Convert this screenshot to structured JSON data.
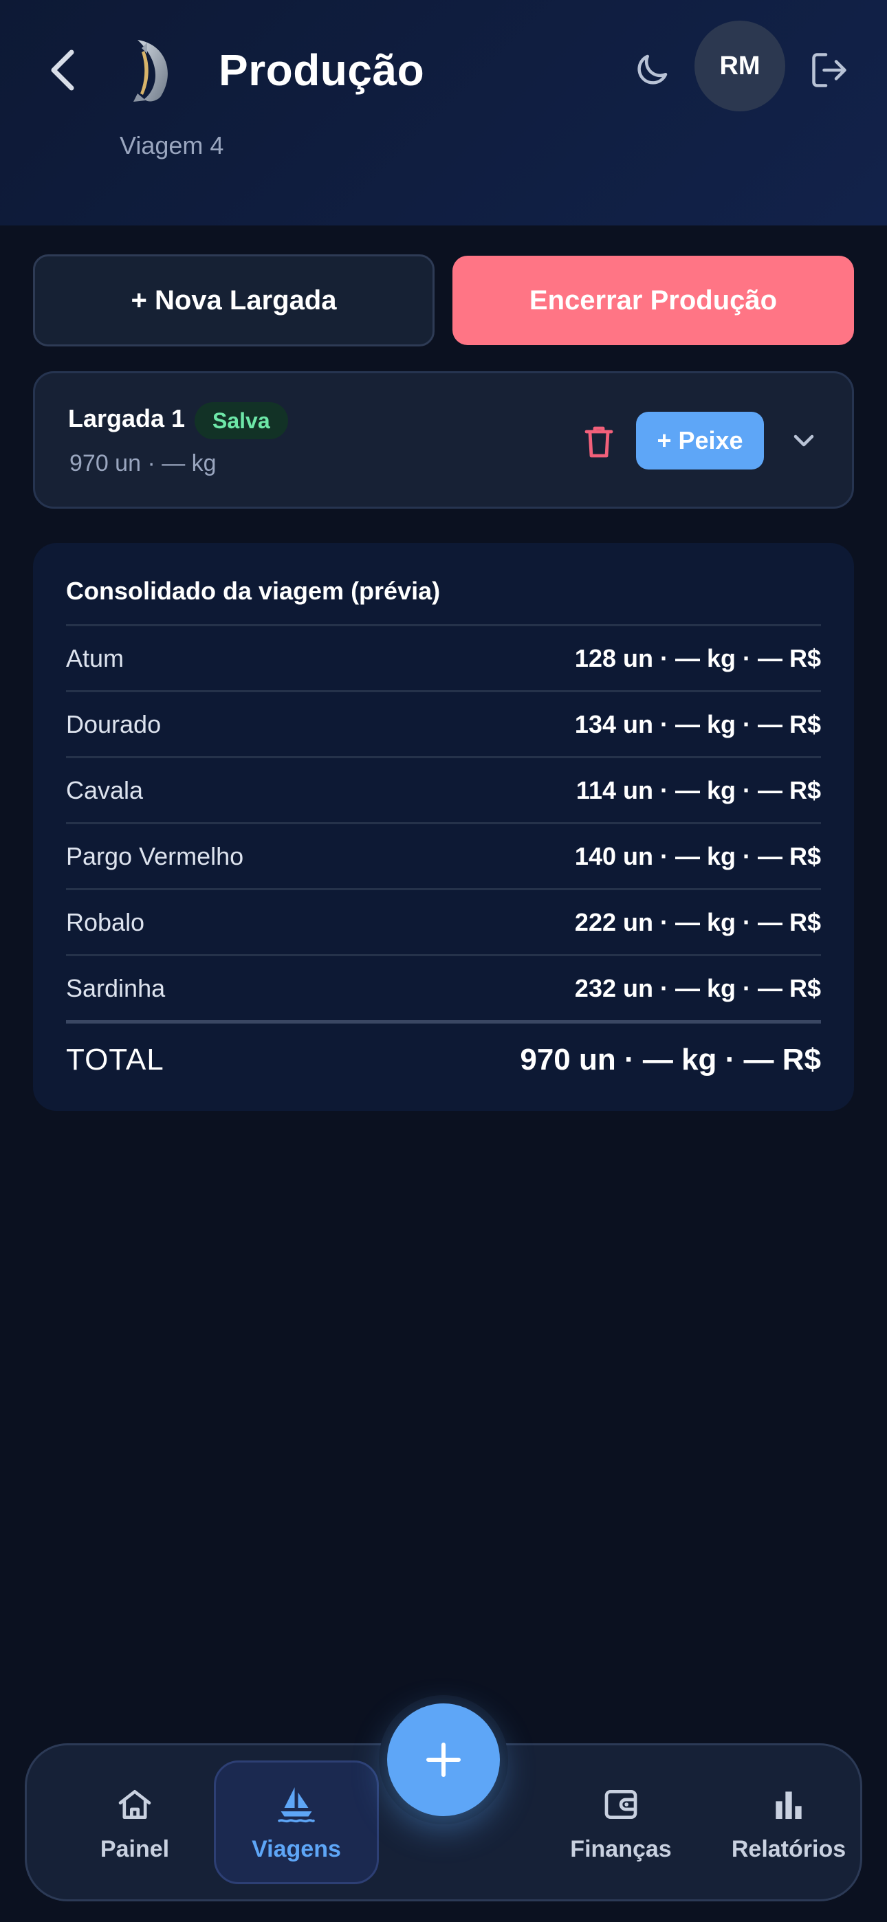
{
  "header": {
    "title": "Produção",
    "subtitle": "Viagem 4",
    "avatar_initials": "RM"
  },
  "actions": {
    "new_label": "+ Nova Largada",
    "close_label": "Encerrar Produção"
  },
  "largada": {
    "title": "Largada 1",
    "badge": "Salva",
    "summary": "970 un · — kg",
    "add_fish_label": "+ Peixe"
  },
  "consolidated": {
    "title": "Consolidado da viagem (prévia)",
    "rows": [
      {
        "name": "Atum",
        "value": "128 un · — kg · — R$"
      },
      {
        "name": "Dourado",
        "value": "134 un · — kg · — R$"
      },
      {
        "name": "Cavala",
        "value": "114 un · — kg · — R$"
      },
      {
        "name": "Pargo Vermelho",
        "value": "140 un · — kg · — R$"
      },
      {
        "name": "Robalo",
        "value": "222 un · — kg · — R$"
      },
      {
        "name": "Sardinha",
        "value": "232 un · — kg · — R$"
      }
    ],
    "total_label": "TOTAL",
    "total_value": "970 un · — kg · — R$"
  },
  "nav": {
    "items": [
      {
        "label": "Painel",
        "icon": "home-icon"
      },
      {
        "label": "Viagens",
        "icon": "sailboat-icon",
        "active": true
      },
      {
        "label": "Finanças",
        "icon": "wallet-icon"
      },
      {
        "label": "Relatórios",
        "icon": "bar-chart-icon"
      }
    ]
  },
  "colors": {
    "accent": "#5ea6f7",
    "danger": "#ff7585",
    "success_text": "#6ee7a8",
    "background": "#0b1120"
  }
}
